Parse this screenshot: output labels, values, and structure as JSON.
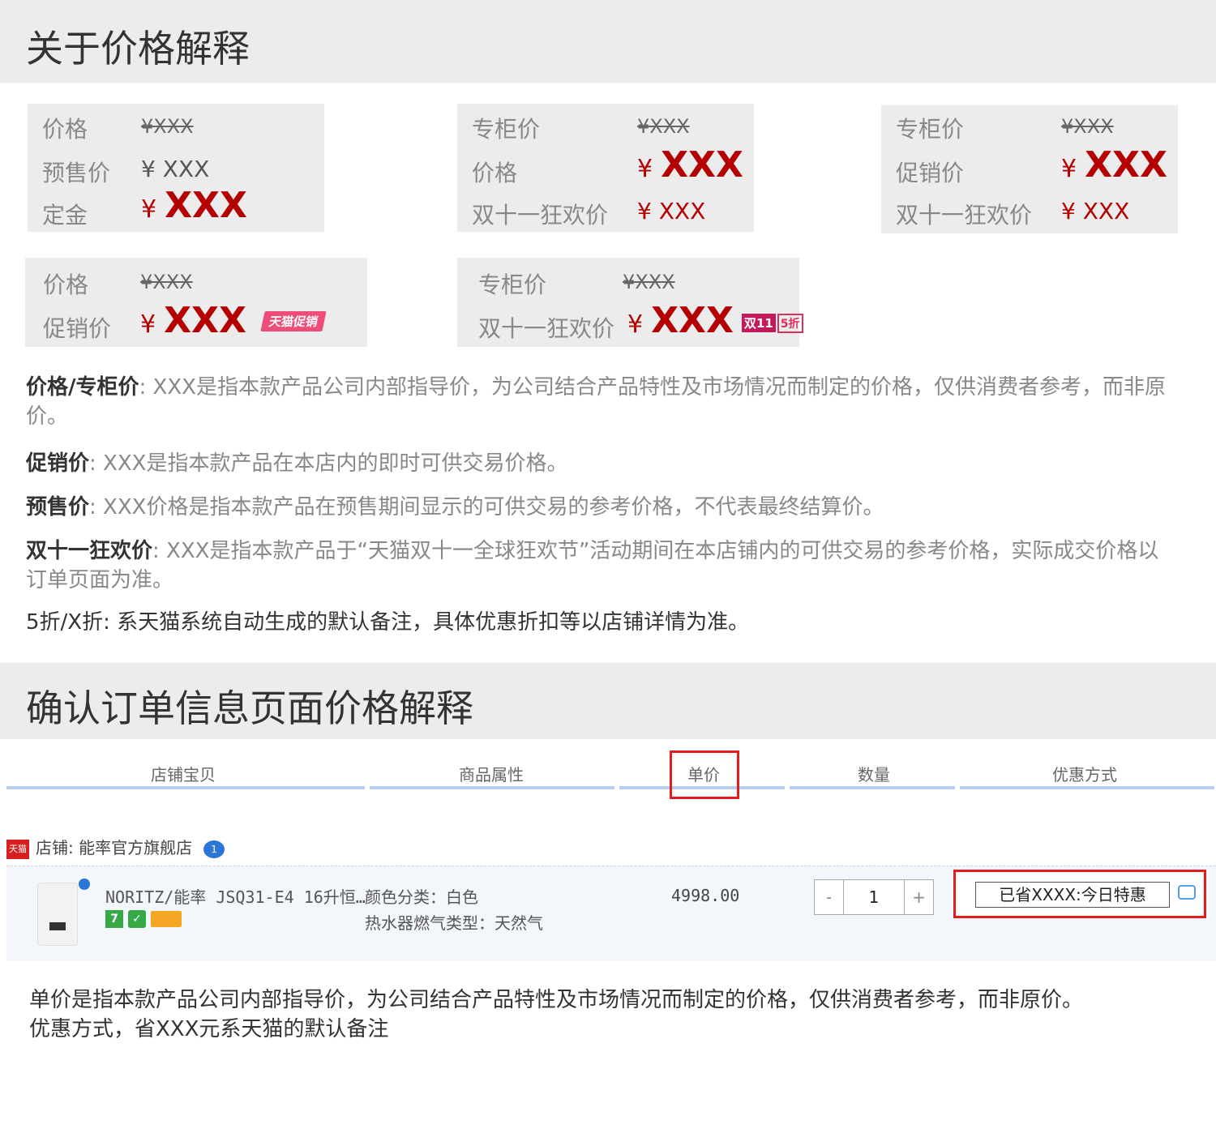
{
  "section1": {
    "title": "关于价格解释"
  },
  "boxes": [
    {
      "rows": [
        {
          "label": "价格",
          "value": "¥XXX"
        },
        {
          "label": "预售价",
          "value": "¥ XXX"
        },
        {
          "label": "定金",
          "currency": "¥",
          "value": "XXX"
        }
      ]
    },
    {
      "rows": [
        {
          "label": "专柜价",
          "value": "¥XXX"
        },
        {
          "label": "价格",
          "currency": "¥",
          "value": "XXX"
        },
        {
          "label": "双十一狂欢价",
          "value": "¥ XXX"
        }
      ]
    },
    {
      "rows": [
        {
          "label": "专柜价",
          "value": "¥XXX"
        },
        {
          "label": "促销价",
          "currency": "¥",
          "value": "XXX"
        },
        {
          "label": "双十一狂欢价",
          "value": "¥ XXX"
        }
      ]
    },
    {
      "rows": [
        {
          "label": "价格",
          "value": "¥XXX"
        },
        {
          "label": "促销价",
          "currency": "¥",
          "value": "XXX",
          "badge": "天猫促销"
        }
      ]
    },
    {
      "rows": [
        {
          "label": "专柜价",
          "value": "¥XXX"
        },
        {
          "label": "双十一狂欢价",
          "currency": "¥",
          "value": "XXX",
          "badge1": "双11",
          "badge2": "5折"
        }
      ]
    }
  ],
  "notes": [
    {
      "term": "价格/专柜价",
      "text": ": XXX是指本款产品公司内部指导价，为公司结合产品特性及市场情况而制定的价格，仅供消费者参考，而非原价。"
    },
    {
      "term": "促销价",
      "text": ": XXX是指本款产品在本店内的即时可供交易价格。"
    },
    {
      "term": "预售价",
      "text": ": XXX价格是指本款产品在预售期间显示的可供交易的参考价格，不代表最终结算价。"
    },
    {
      "term": "双十一狂欢价",
      "text": ": XXX是指本款产品于“天猫双十一全球狂欢节”活动期间在本店铺内的可供交易的参考价格，实际成交价格以订单页面为准。"
    },
    {
      "term": "",
      "text": "5折/X折: 系天猫系统自动生成的默认备注，具体优惠折扣等以店铺详情为准。"
    }
  ],
  "section2": {
    "title": "确认订单信息页面价格解释"
  },
  "table": {
    "headers": [
      "店铺宝贝",
      "商品属性",
      "单价",
      "数量",
      "优惠方式"
    ],
    "shop_label": "店铺: 能率官方旗舰店",
    "shop_icon_text": "天猫",
    "shop_bubble": "1",
    "item": {
      "name": "NORITZ/能率 JSQ31-E4 16升恒…",
      "attr1": "颜色分类：白色",
      "attr2": "热水器燃气类型：天然气",
      "unit_price": "4998.00",
      "qty_minus": "-",
      "qty": "1",
      "qty_plus": "+",
      "discount": "已省XXXX:今日特惠",
      "icon7": "7"
    }
  },
  "footer": {
    "line1": "单价是指本款产品公司内部指导价，为公司结合产品特性及市场情况而制定的价格，仅供消费者参考，而非原价。",
    "line2": "优惠方式，省XXX元系天猫的默认备注"
  }
}
